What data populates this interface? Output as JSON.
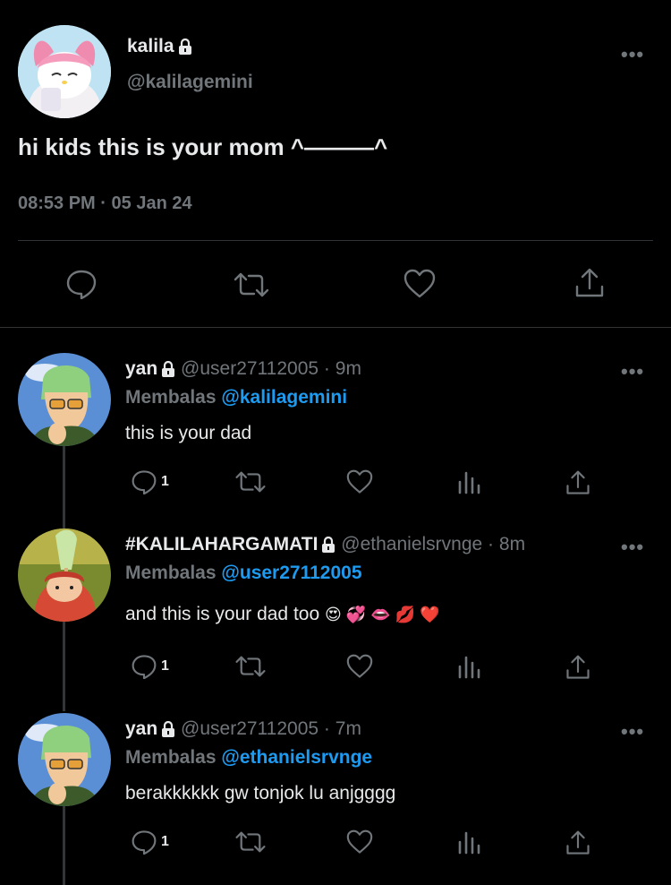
{
  "main_tweet": {
    "display_name": "kalila",
    "handle": "@kalilagemini",
    "text": "hi kids this is your mom ^———^",
    "time": "08:53 PM",
    "sep": "·",
    "date": "05 Jan 24"
  },
  "replies": [
    {
      "display_name": "yan",
      "handle": "@user27112005",
      "sep": "·",
      "age": "9m",
      "replying_label": "Membalas",
      "replying_to": "@kalilagemini",
      "text": "this is your dad",
      "reply_count": "1"
    },
    {
      "display_name": "#KALILAHARGAMATI",
      "handle": "@ethanielsrvnge",
      "sep": "·",
      "age": "8m",
      "replying_label": "Membalas",
      "replying_to": "@user27112005",
      "text": "and this is your dad too",
      "emojis": "😍 💞 👄 💋 ❤️",
      "reply_count": "1"
    },
    {
      "display_name": "yan",
      "handle": "@user27112005",
      "sep": "·",
      "age": "7m",
      "replying_label": "Membalas",
      "replying_to": "@ethanielsrvnge",
      "text": "berakkkkkk gw tonjok lu anjgggg",
      "reply_count": "1"
    }
  ],
  "more_glyph": "•••",
  "colors": {
    "background": "#000000",
    "text": "#e7e9ea",
    "secondary": "#71767b",
    "link": "#1d9bf0"
  },
  "icons": [
    "lock-icon",
    "more-icon",
    "reply-icon",
    "retweet-icon",
    "like-icon",
    "analytics-icon",
    "share-icon"
  ]
}
